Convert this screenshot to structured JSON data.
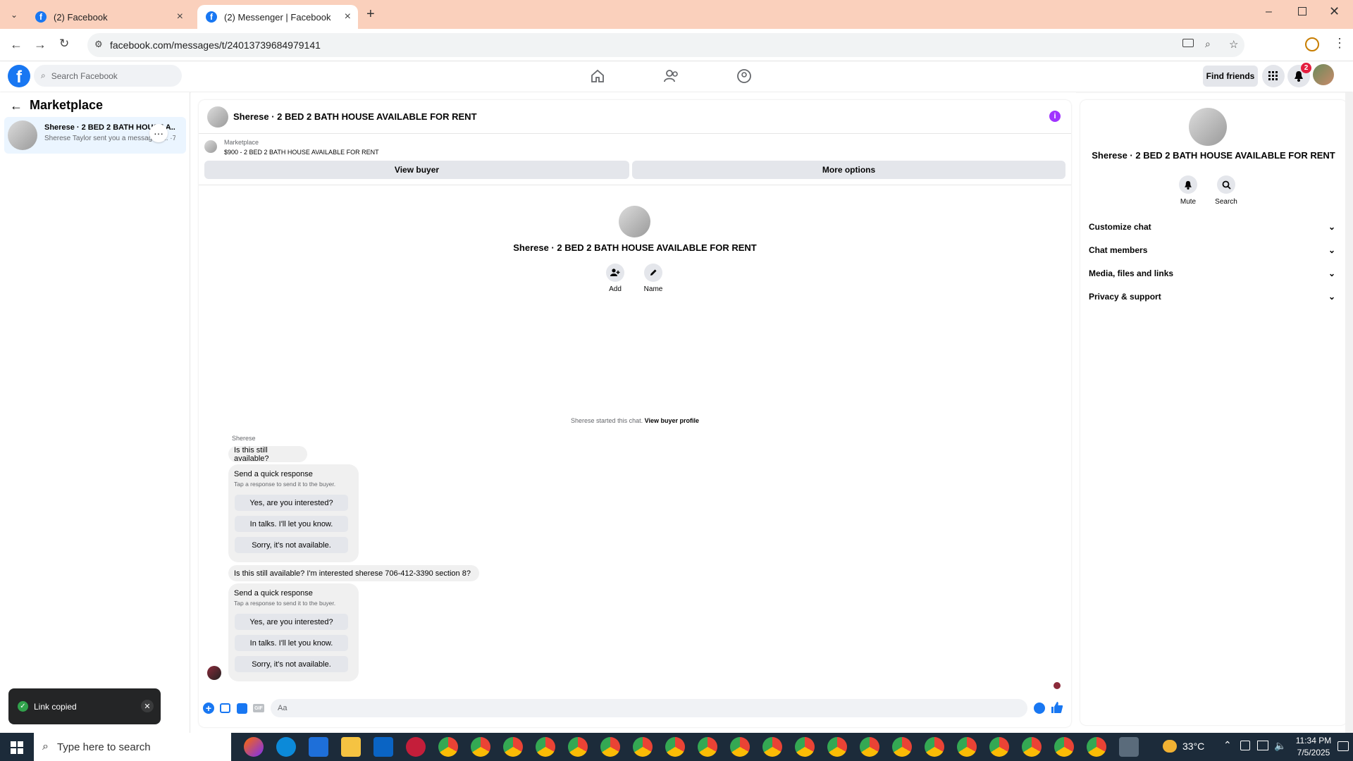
{
  "browser": {
    "tabs": [
      {
        "title": "(2) Facebook"
      },
      {
        "title": "(2) Messenger | Facebook"
      }
    ],
    "url": "facebook.com/messages/t/24013739684979141"
  },
  "fb_header": {
    "search_placeholder": "Search Facebook",
    "find_friends": "Find friends",
    "notifications_count": "2"
  },
  "left": {
    "title": "Marketplace",
    "conversation": {
      "name": "Sherese · 2 BED 2 BATH HOUSE A...",
      "snippet": "Sherese Taylor sent you a message a... ·7m"
    }
  },
  "chat": {
    "header_title": "Sherese · 2 BED 2 BATH HOUSE AVAILABLE FOR RENT",
    "listing_label": "Marketplace",
    "listing_info": "$900 - 2 BED 2 BATH HOUSE AVAILABLE FOR RENT",
    "view_buyer": "View buyer",
    "more_options": "More options",
    "profile_name": "Sherese · 2 BED 2 BATH HOUSE AVAILABLE FOR RENT",
    "add_label": "Add",
    "name_label": "Name",
    "started_text": "Sherese started this chat.",
    "view_buyer_profile": "View buyer profile",
    "sender_name": "Sherese",
    "msg1": "Is this still available?",
    "msg2": "Is this still available? I'm interested sherese 706-412-3390 section 8?",
    "quick_title": "Send a quick response",
    "quick_sub": "Tap a response to send it to the buyer.",
    "quick_options": [
      "Yes, are you interested?",
      "In talks. I'll let you know.",
      "Sorry, it's not available."
    ],
    "composer_placeholder": "Aa"
  },
  "right": {
    "title": "Sherese · 2 BED 2 BATH HOUSE AVAILABLE FOR RENT",
    "mute": "Mute",
    "search": "Search",
    "sections": [
      "Customize chat",
      "Chat members",
      "Media, files and links",
      "Privacy & support"
    ]
  },
  "toast": {
    "text": "Link copied"
  },
  "taskbar": {
    "search_placeholder": "Type here to search",
    "temperature": "33°C",
    "time": "11:34 PM",
    "date": "7/5/2025"
  },
  "colors": {
    "fb_blue": "#1877f2",
    "tabstrip": "#fad0bc",
    "info_purple": "#a033ff",
    "taskbar": "#1c2b3a"
  }
}
